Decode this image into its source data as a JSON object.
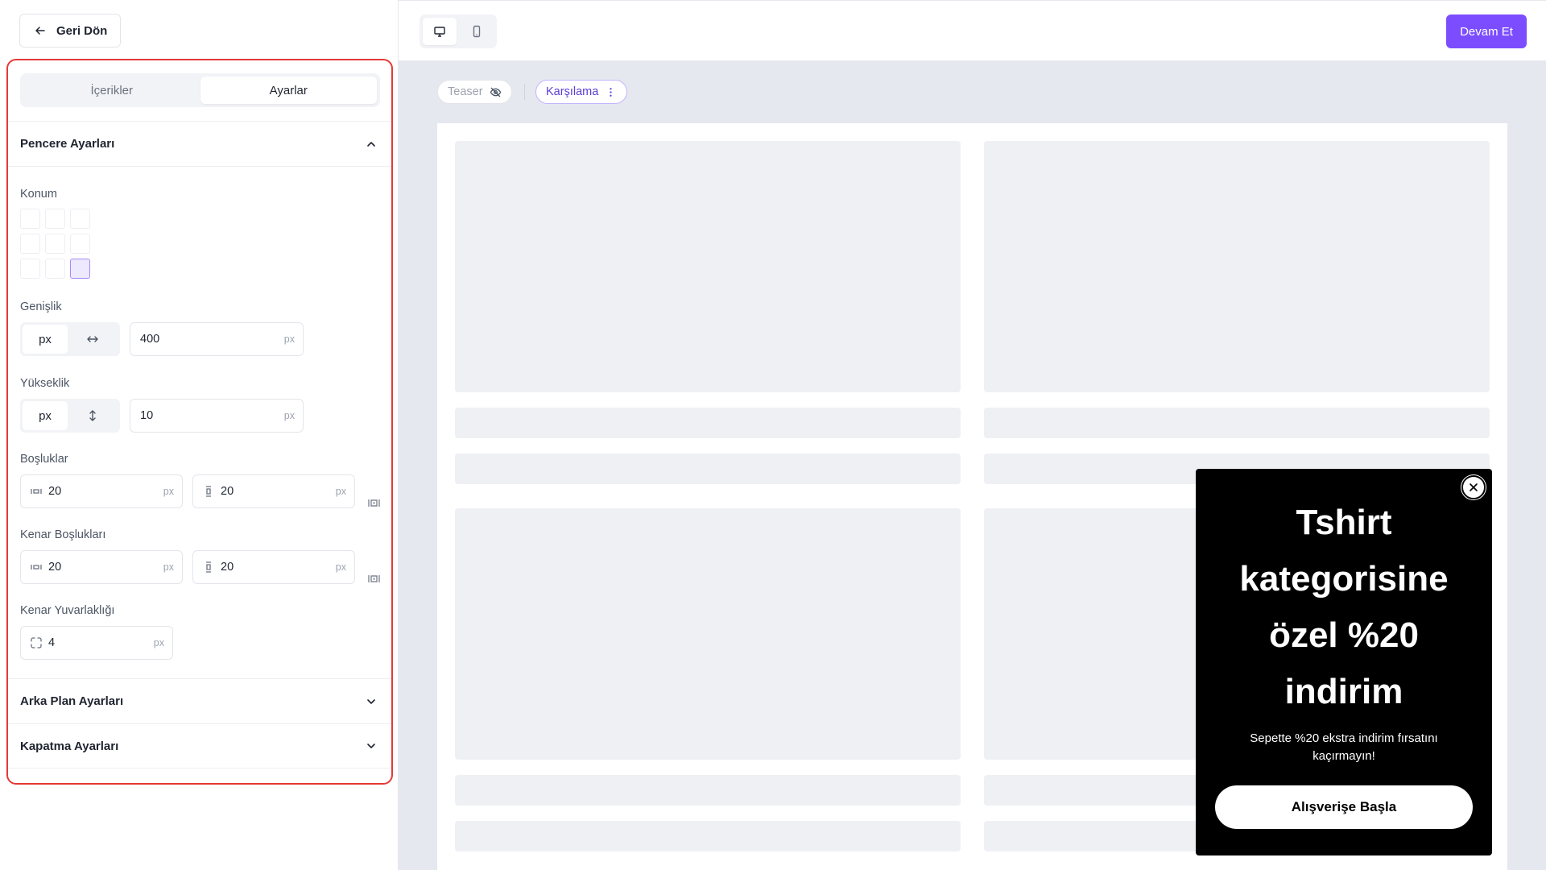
{
  "sidebar": {
    "back_label": "Geri Dön",
    "tabs": [
      {
        "label": "İçerikler",
        "active": false
      },
      {
        "label": "Ayarlar",
        "active": true
      }
    ],
    "window_settings": {
      "title": "Pencere Ayarları",
      "expanded": true,
      "position_label": "Konum",
      "position_selected": "bottom-right",
      "width": {
        "label": "Genişlik",
        "unit": "px",
        "value": "400",
        "suffix": "px"
      },
      "height": {
        "label": "Yükseklik",
        "unit": "px",
        "value": "10",
        "suffix": "px"
      },
      "padding": {
        "label": "Boşluklar",
        "horizontal": "20",
        "vertical": "20",
        "suffix": "px"
      },
      "margin": {
        "label": "Kenar Boşlukları",
        "horizontal": "20",
        "vertical": "20",
        "suffix": "px"
      },
      "radius": {
        "label": "Kenar Yuvarlaklığı",
        "value": "4",
        "suffix": "px"
      }
    },
    "background_settings": {
      "title": "Arka Plan Ayarları",
      "expanded": false
    },
    "close_settings": {
      "title": "Kapatma Ayarları",
      "expanded": false
    }
  },
  "topbar": {
    "active_device": "desktop",
    "continue_label": "Devam Et"
  },
  "canvas": {
    "chips": {
      "teaser": "Teaser",
      "welcome": "Karşılama"
    }
  },
  "popup": {
    "title": "Tshirt kategorisine özel %20 indirim",
    "subtitle": "Sepette %20 ekstra indirim fırsatını kaçırmayın!",
    "button_label": "Alışverişe Başla"
  },
  "colors": {
    "accent": "#7c4dff",
    "highlight_border": "#e53935",
    "canvas_bg": "#e5e8ef",
    "popup_bg": "#000000"
  }
}
